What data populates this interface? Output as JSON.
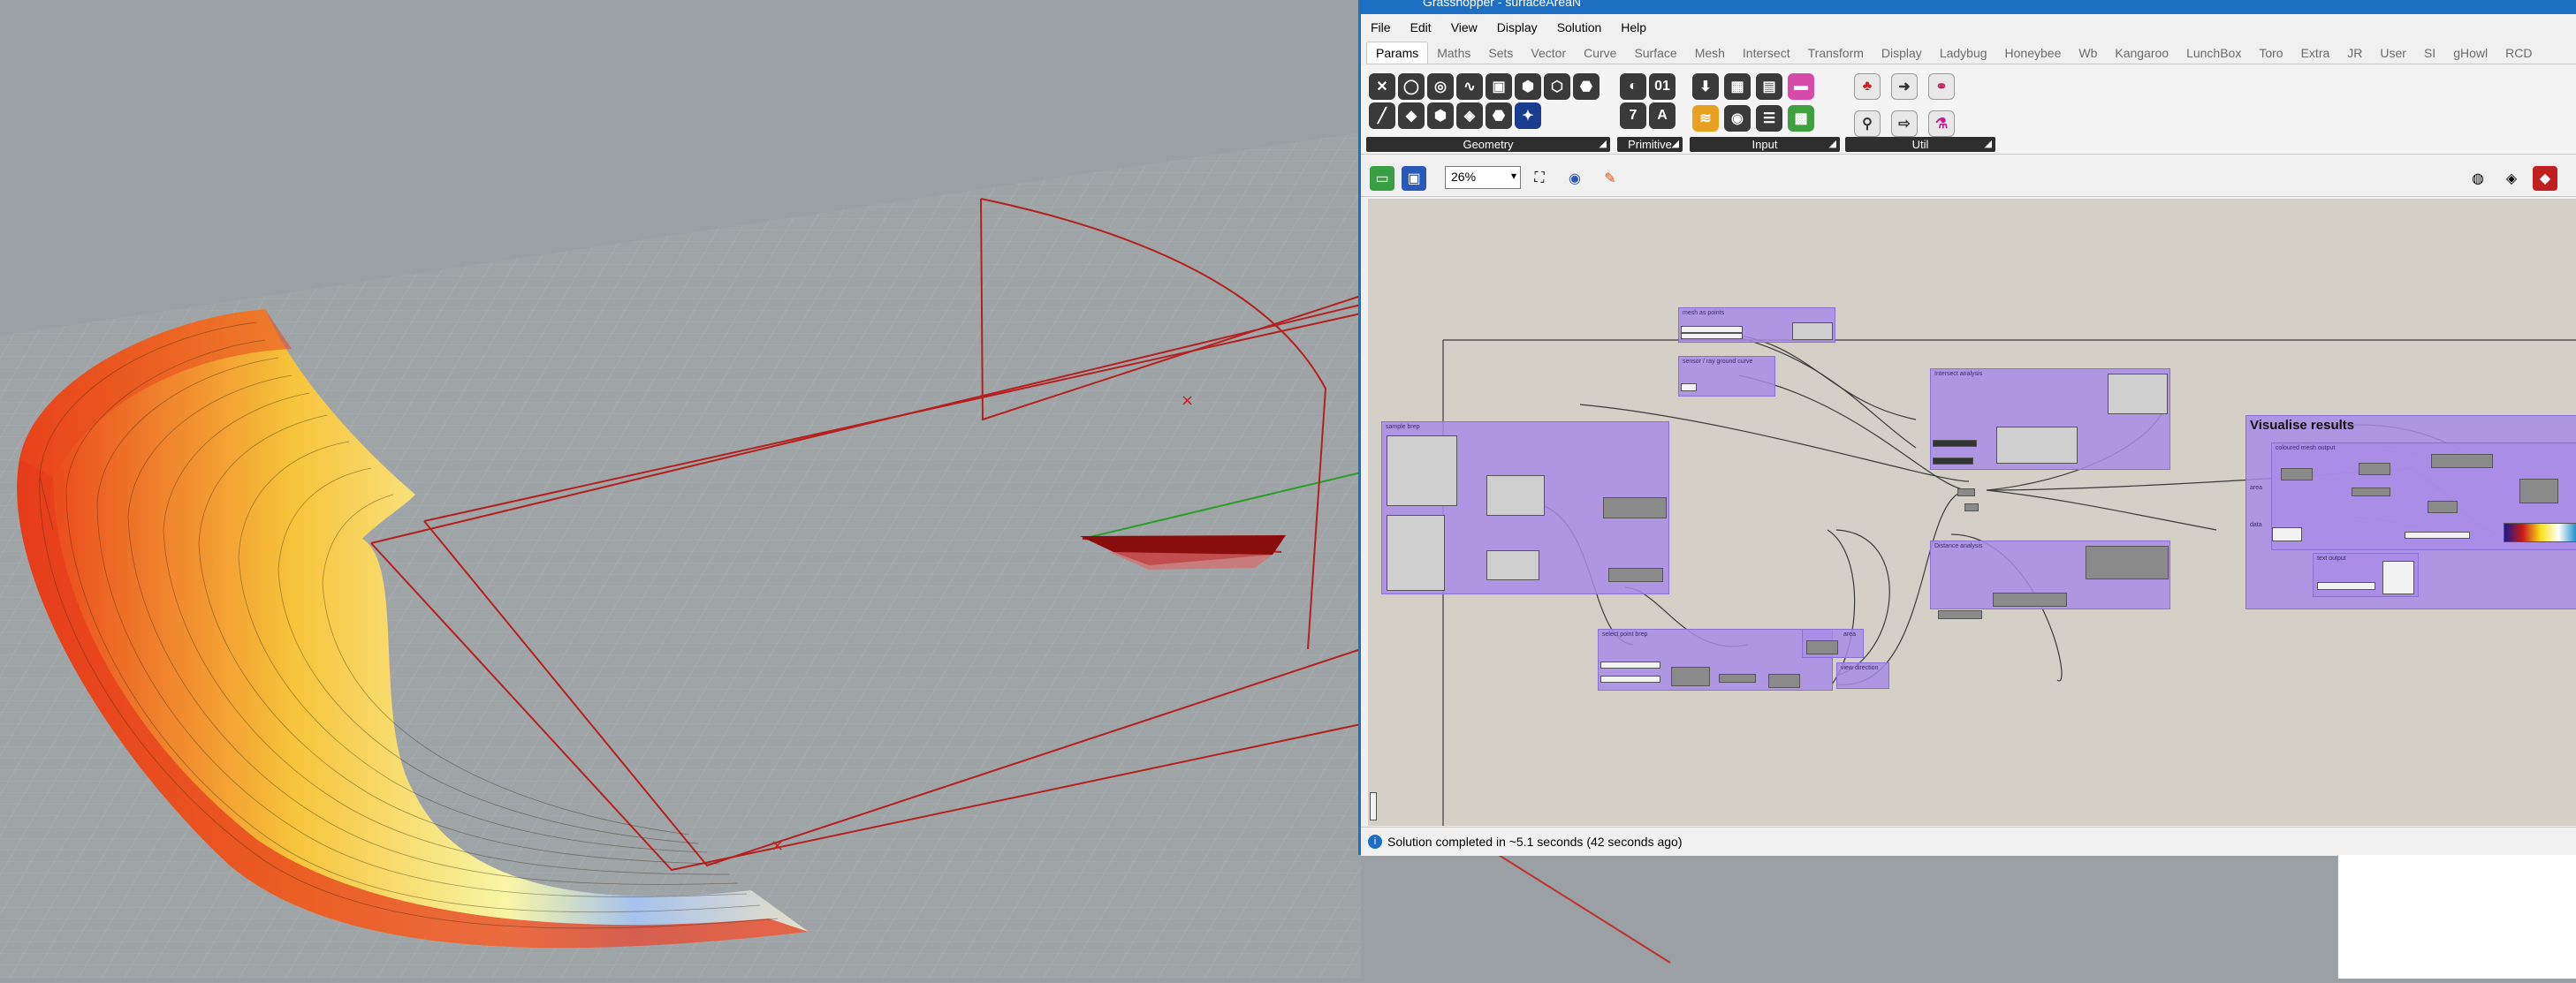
{
  "window": {
    "title": "Grasshopper - surfaceAreaN"
  },
  "menu": [
    "File",
    "Edit",
    "View",
    "Display",
    "Solution",
    "Help"
  ],
  "tabs": [
    "Params",
    "Maths",
    "Sets",
    "Vector",
    "Curve",
    "Surface",
    "Mesh",
    "Intersect",
    "Transform",
    "Display",
    "Ladybug",
    "Honeybee",
    "Wb",
    "Kangaroo",
    "LunchBox",
    "Toro",
    "Extra",
    "JR",
    "User",
    "SI",
    "gHowl",
    "RCD"
  ],
  "ribbon_groups": [
    {
      "label": "Geometry",
      "icons": [
        "point-x",
        "circle",
        "ring",
        "curve",
        "box",
        "brep",
        "plane",
        "field",
        "line",
        "mesh",
        "hex",
        "surface",
        "group",
        "vector"
      ]
    },
    {
      "label": "Primitive",
      "icons": [
        "bool",
        "01",
        "7",
        "A"
      ]
    },
    {
      "label": "Input",
      "icons": [
        "download",
        "grid",
        "toggle",
        "gradient",
        "swatch",
        "dial",
        "list",
        "image"
      ]
    },
    {
      "label": "Util",
      "icons": [
        "cherries",
        "arrow",
        "links",
        "bolt",
        "hollow-arrow",
        "flask"
      ]
    }
  ],
  "toolbar": {
    "zoom": "26%"
  },
  "canvas": {
    "groups": {
      "g1": "mesh as points",
      "g2": "sensor / ray ground curve",
      "g3": "sample brep",
      "g4": "Intersect analysis",
      "g5": "select point brep",
      "g6": "area",
      "g7": "view direction",
      "g8": "Distance analysis",
      "g9": "Visualise results",
      "g10": "coloured mesh output",
      "g11": "text output"
    },
    "labels": {
      "area_in": "area",
      "data_in": "data"
    }
  },
  "status": {
    "text": "Solution completed in ~5.1 seconds (42 seconds ago)"
  },
  "colors": {
    "titlebar": "#1c6fc2",
    "group_fill": "#a88ce8",
    "canvas": "#d4d0c8",
    "viewport_bg": "#9aa0a3",
    "wire": "#b01818"
  }
}
